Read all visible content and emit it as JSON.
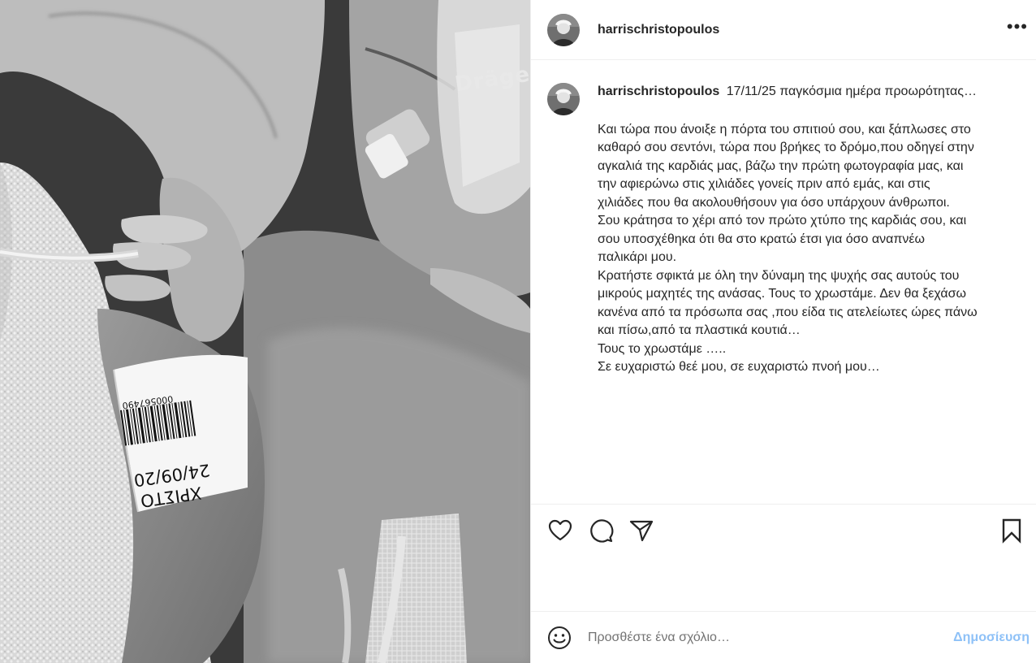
{
  "post": {
    "username": "harrischristopoulos",
    "more_label": "•••",
    "photo": {
      "wristband_number": "000567490",
      "wristband_date": "24/09/20",
      "wristband_name": "ΧΡΙΣΤΟ",
      "brand": "Dräger"
    },
    "caption": {
      "username": "harrischristopoulos",
      "headline": "17/11/25 παγκόσμια ημέρα προωρότητας…",
      "lines": [
        "Και τώρα που άνοιξε η πόρτα του σπιτιού σου, και ξάπλωσες στο",
        "καθαρό σου σεντόνι, τώρα που βρήκες το δρόμο,που οδηγεί στην",
        "αγκαλιά της καρδιάς μας, βάζω την πρώτη φωτογραφία μας, και",
        "την αφιερώνω στις χιλιάδες γονείς πριν από εμάς, και στις",
        "χιλιάδες που θα ακολουθήσουν για όσο υπάρχουν άνθρωποι.",
        "Σου κράτησα το χέρι από τον πρώτο χτύπο της καρδιάς σου, και",
        "σου υποσχέθηκα ότι θα στο κρατώ έτσι για όσο αναπνέω",
        "παλικάρι μου.",
        "Κρατήστε σφικτά με όλη την δύναμη της ψυχής σας αυτούς του",
        "μικρούς μαχητές της ανάσας. Τους το χρωστάμε. Δεν θα ξεχάσω",
        "κανένα από τα πρόσωπα σας ,που είδα τις ατελείωτες ώρες πάνω",
        "και πίσω,από τα πλαστικά κουτιά…",
        "Τους το χρωστάμε …..",
        "Σε ευχαριστώ θεέ μου, σε ευχαριστώ πνοή μου…"
      ]
    },
    "icons": {
      "like": "heart-icon",
      "comment": "comment-icon",
      "share": "send-icon",
      "save": "bookmark-icon",
      "emoji": "emoji-icon",
      "more": "more-icon"
    },
    "comment_box": {
      "placeholder": "Προσθέστε ένα σχόλιο…",
      "publish_label": "Δημοσίευση"
    },
    "colors": {
      "publish": "#8ec1f7",
      "text": "#262626",
      "divider": "#efefef"
    }
  }
}
